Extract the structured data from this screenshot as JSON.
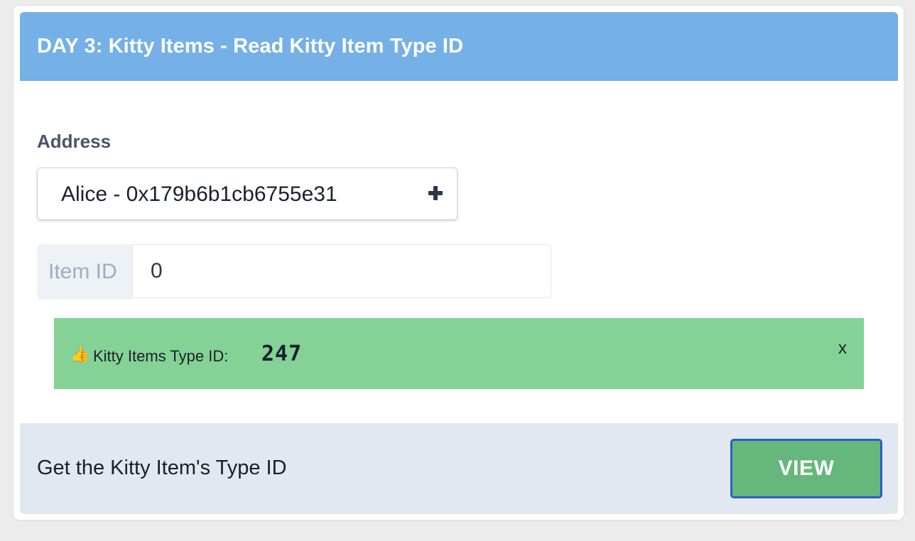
{
  "card": {
    "title": "DAY 3: Kitty Items - Read Kitty Item Type ID"
  },
  "form": {
    "address_label": "Address",
    "address_selected": "Alice - 0x179b6b1cb6755e31",
    "address_add_icon": "plus-icon",
    "item_id_label": "Item ID",
    "item_id_value": "0"
  },
  "alert": {
    "icon": "thumbs-up-icon",
    "label": "Kitty Items Type ID:",
    "value": "247",
    "close_label": "x"
  },
  "footer": {
    "description": "Get the Kitty Item's Type ID",
    "button_label": "VIEW"
  },
  "colors": {
    "header_bg": "#75b0e6",
    "alert_bg": "#84d296",
    "footer_bg": "#e2e8f0",
    "button_bg": "#66b77c",
    "button_border": "#2b5fc4"
  }
}
